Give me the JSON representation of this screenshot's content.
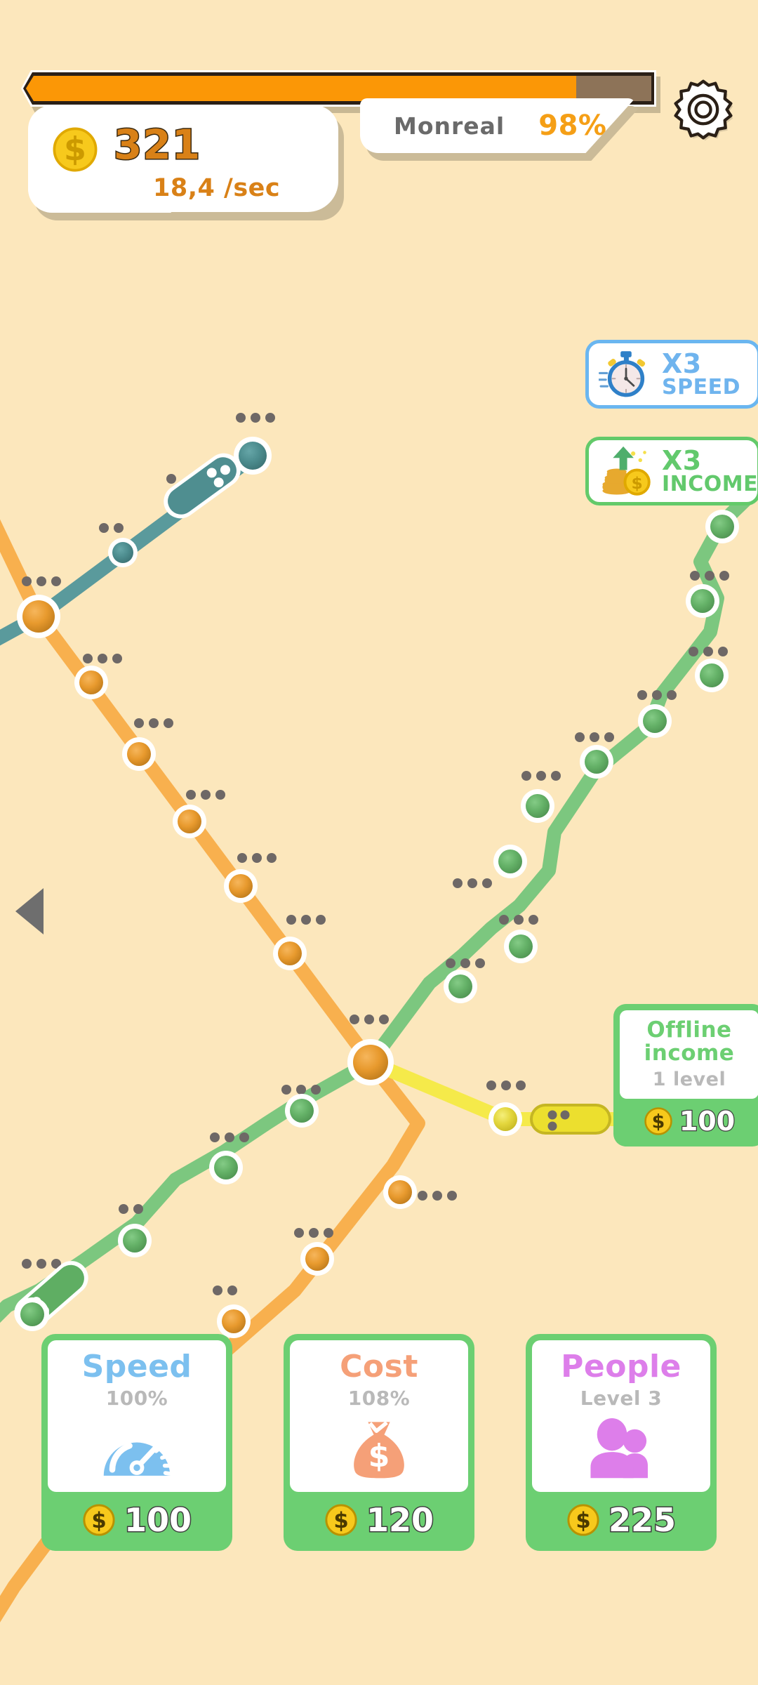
{
  "app": {
    "background_color": "#fce7bc",
    "title": "Metro Idle Game"
  },
  "hud": {
    "progress": {
      "name": "level-progress-bar",
      "percent": 88,
      "fill_color": "#fb9706",
      "track_color": "#8d7358"
    },
    "settings_icon": "gear-icon",
    "money": {
      "coin_icon": "coin-icon",
      "amount": "321",
      "rate": "18,4 /sec",
      "amount_color": "#d98117"
    },
    "city": {
      "name": "Monreal",
      "percent": "98%",
      "name_color": "#6a6a6a",
      "percent_color": "#f59f16"
    }
  },
  "boosts": [
    {
      "id": "boost-speed",
      "icon": "stopwatch-icon",
      "multiplier": "X3",
      "label": "SPEED",
      "color": "#6fb4ee"
    },
    {
      "id": "boost-income",
      "icon": "coins-up-arrow-icon",
      "multiplier": "X3",
      "label": "INCOME",
      "color": "#62c96c"
    }
  ],
  "nav": {
    "prev_arrow_icon": "triangle-left-icon",
    "prev_arrow_color": "#6e6e6e"
  },
  "offline_card": {
    "title_line1": "Offline",
    "title_line2": "income",
    "level": "1 level",
    "price": "100",
    "coin_icon": "coin-icon",
    "accent_color": "#6ccf72"
  },
  "upgrades": [
    {
      "id": "upgrade-speed",
      "title": "Speed",
      "title_class": "t-speed",
      "value": "100%",
      "icon": "speedometer-icon",
      "icon_color": "#7cc0ef",
      "price": "100",
      "coin_icon": "coin-icon"
    },
    {
      "id": "upgrade-cost",
      "title": "Cost",
      "title_class": "t-cost",
      "value": "108%",
      "icon": "money-bag-icon",
      "icon_color": "#f5a078",
      "price": "120",
      "coin_icon": "coin-icon"
    },
    {
      "id": "upgrade-people",
      "title": "People",
      "title_class": "t-people",
      "value": "Level 3",
      "icon": "people-icon",
      "icon_color": "#dd7eea",
      "price": "225",
      "coin_icon": "coin-icon"
    }
  ],
  "map": {
    "lines": [
      {
        "id": "teal-line",
        "color": "#5a9a9c",
        "stations": 3
      },
      {
        "id": "orange-line",
        "color": "#f8b04e",
        "stations": 10
      },
      {
        "id": "green-line",
        "color": "#7cc77f",
        "stations": 13
      },
      {
        "id": "yellow-line",
        "color": "#f5ea4a",
        "stations": 1
      }
    ],
    "trains": [
      {
        "id": "teal-train",
        "color": "#4f8e90"
      },
      {
        "id": "green-train",
        "color": "#5fae63"
      },
      {
        "id": "yellow-train",
        "color": "#ecdf2e"
      }
    ],
    "interchange_station": {
      "id": "central-hub",
      "color": "#f0a23a"
    },
    "passenger_dot_color": "#6e6866"
  }
}
